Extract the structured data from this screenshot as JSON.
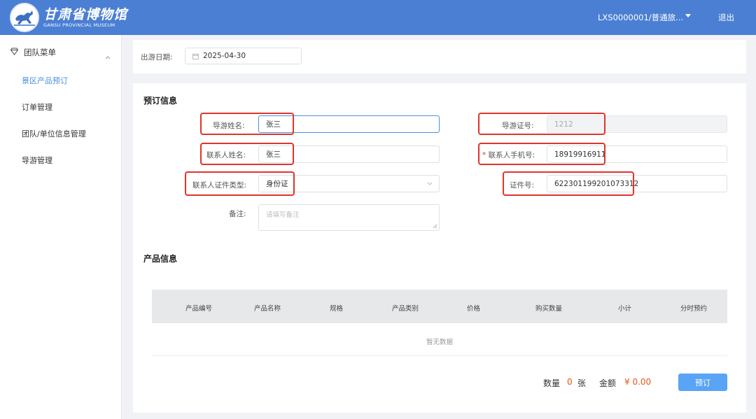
{
  "brand": {
    "name_cn": "甘肃省博物馆",
    "name_en": "GANSU PROVINCIAL MUSEUM"
  },
  "header": {
    "user": "LXS0000001/普通旅...",
    "logout": "退出"
  },
  "sidebar": {
    "group": "团队菜单",
    "items": [
      {
        "label": "景区产品预订",
        "active": true
      },
      {
        "label": "订单管理"
      },
      {
        "label": "团队/单位信息管理"
      },
      {
        "label": "导游管理"
      }
    ]
  },
  "date_filter": {
    "label": "出游日期:",
    "value": "2025-04-30"
  },
  "booking": {
    "title": "预订信息",
    "guide_name": {
      "label": "导游姓名:",
      "value": "张三"
    },
    "guide_cert": {
      "label": "导游证号:",
      "value": "1212"
    },
    "contact_name": {
      "label": "联系人姓名:",
      "value": "张三"
    },
    "contact_phone": {
      "required_mark": "*",
      "label": "联系人手机号:",
      "value": "18919916911"
    },
    "id_type": {
      "label": "联系人证件类型:",
      "value": "身份证"
    },
    "id_number": {
      "label": "证件号:",
      "value": "622301199201073312"
    },
    "remark": {
      "label": "备注:",
      "placeholder": "请填写备注"
    }
  },
  "products": {
    "title": "产品信息",
    "columns": [
      "产品编号",
      "产品名称",
      "规格",
      "产品类别",
      "价格",
      "购买数量",
      "小计",
      "分时预约"
    ],
    "empty_text": "暂无数据"
  },
  "summary": {
    "qty_label": "数量",
    "qty_value": "0",
    "qty_unit": "张",
    "amount_label": "金额",
    "amount_value": "¥ 0.00",
    "submit": "预订"
  },
  "colors": {
    "header": "#4a7fd4",
    "accent": "#4a90e2",
    "highlight": "#e0342b",
    "price": "#e8541b",
    "button": "#5aa4f5"
  }
}
